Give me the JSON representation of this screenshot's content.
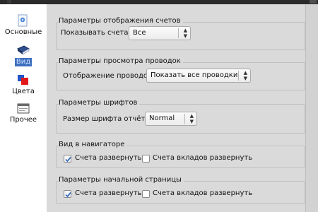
{
  "sidebar": {
    "items": [
      {
        "label": "Основные",
        "icon": "settings-page-icon",
        "selected": false
      },
      {
        "label": "Вид",
        "icon": "book-icon",
        "selected": true
      },
      {
        "label": "Цвета",
        "icon": "palette-icon",
        "selected": false
      },
      {
        "label": "Прочее",
        "icon": "window-icon",
        "selected": false
      }
    ]
  },
  "accounts_display": {
    "title": "Параметры отображения счетов",
    "label": "Показывать счета",
    "value": "Все"
  },
  "transactions_view": {
    "title": "Параметры просмотра проводок",
    "label": "Отображение проводок",
    "value": "Показать все проводки"
  },
  "fonts": {
    "title": "Параметры шрифтов",
    "label": "Размер шрифта отчёта",
    "value": "Normal"
  },
  "navigator": {
    "title": "Вид в навигаторе",
    "expand_accounts": {
      "label": "Счета развернуть",
      "checked": true
    },
    "expand_deposits": {
      "label": "Счета вкладов развернуть",
      "checked": false
    }
  },
  "home_page": {
    "title": "Параметры начальной страницы",
    "expand_accounts": {
      "label": "Счета развернуть",
      "checked": true
    },
    "expand_deposits": {
      "label": "Счета вкладов развернуть",
      "checked": false
    }
  },
  "colors": {
    "selection": "#3d6fc0",
    "sidebar_bg": "#ffffff",
    "panel_bg": "#dadada"
  }
}
